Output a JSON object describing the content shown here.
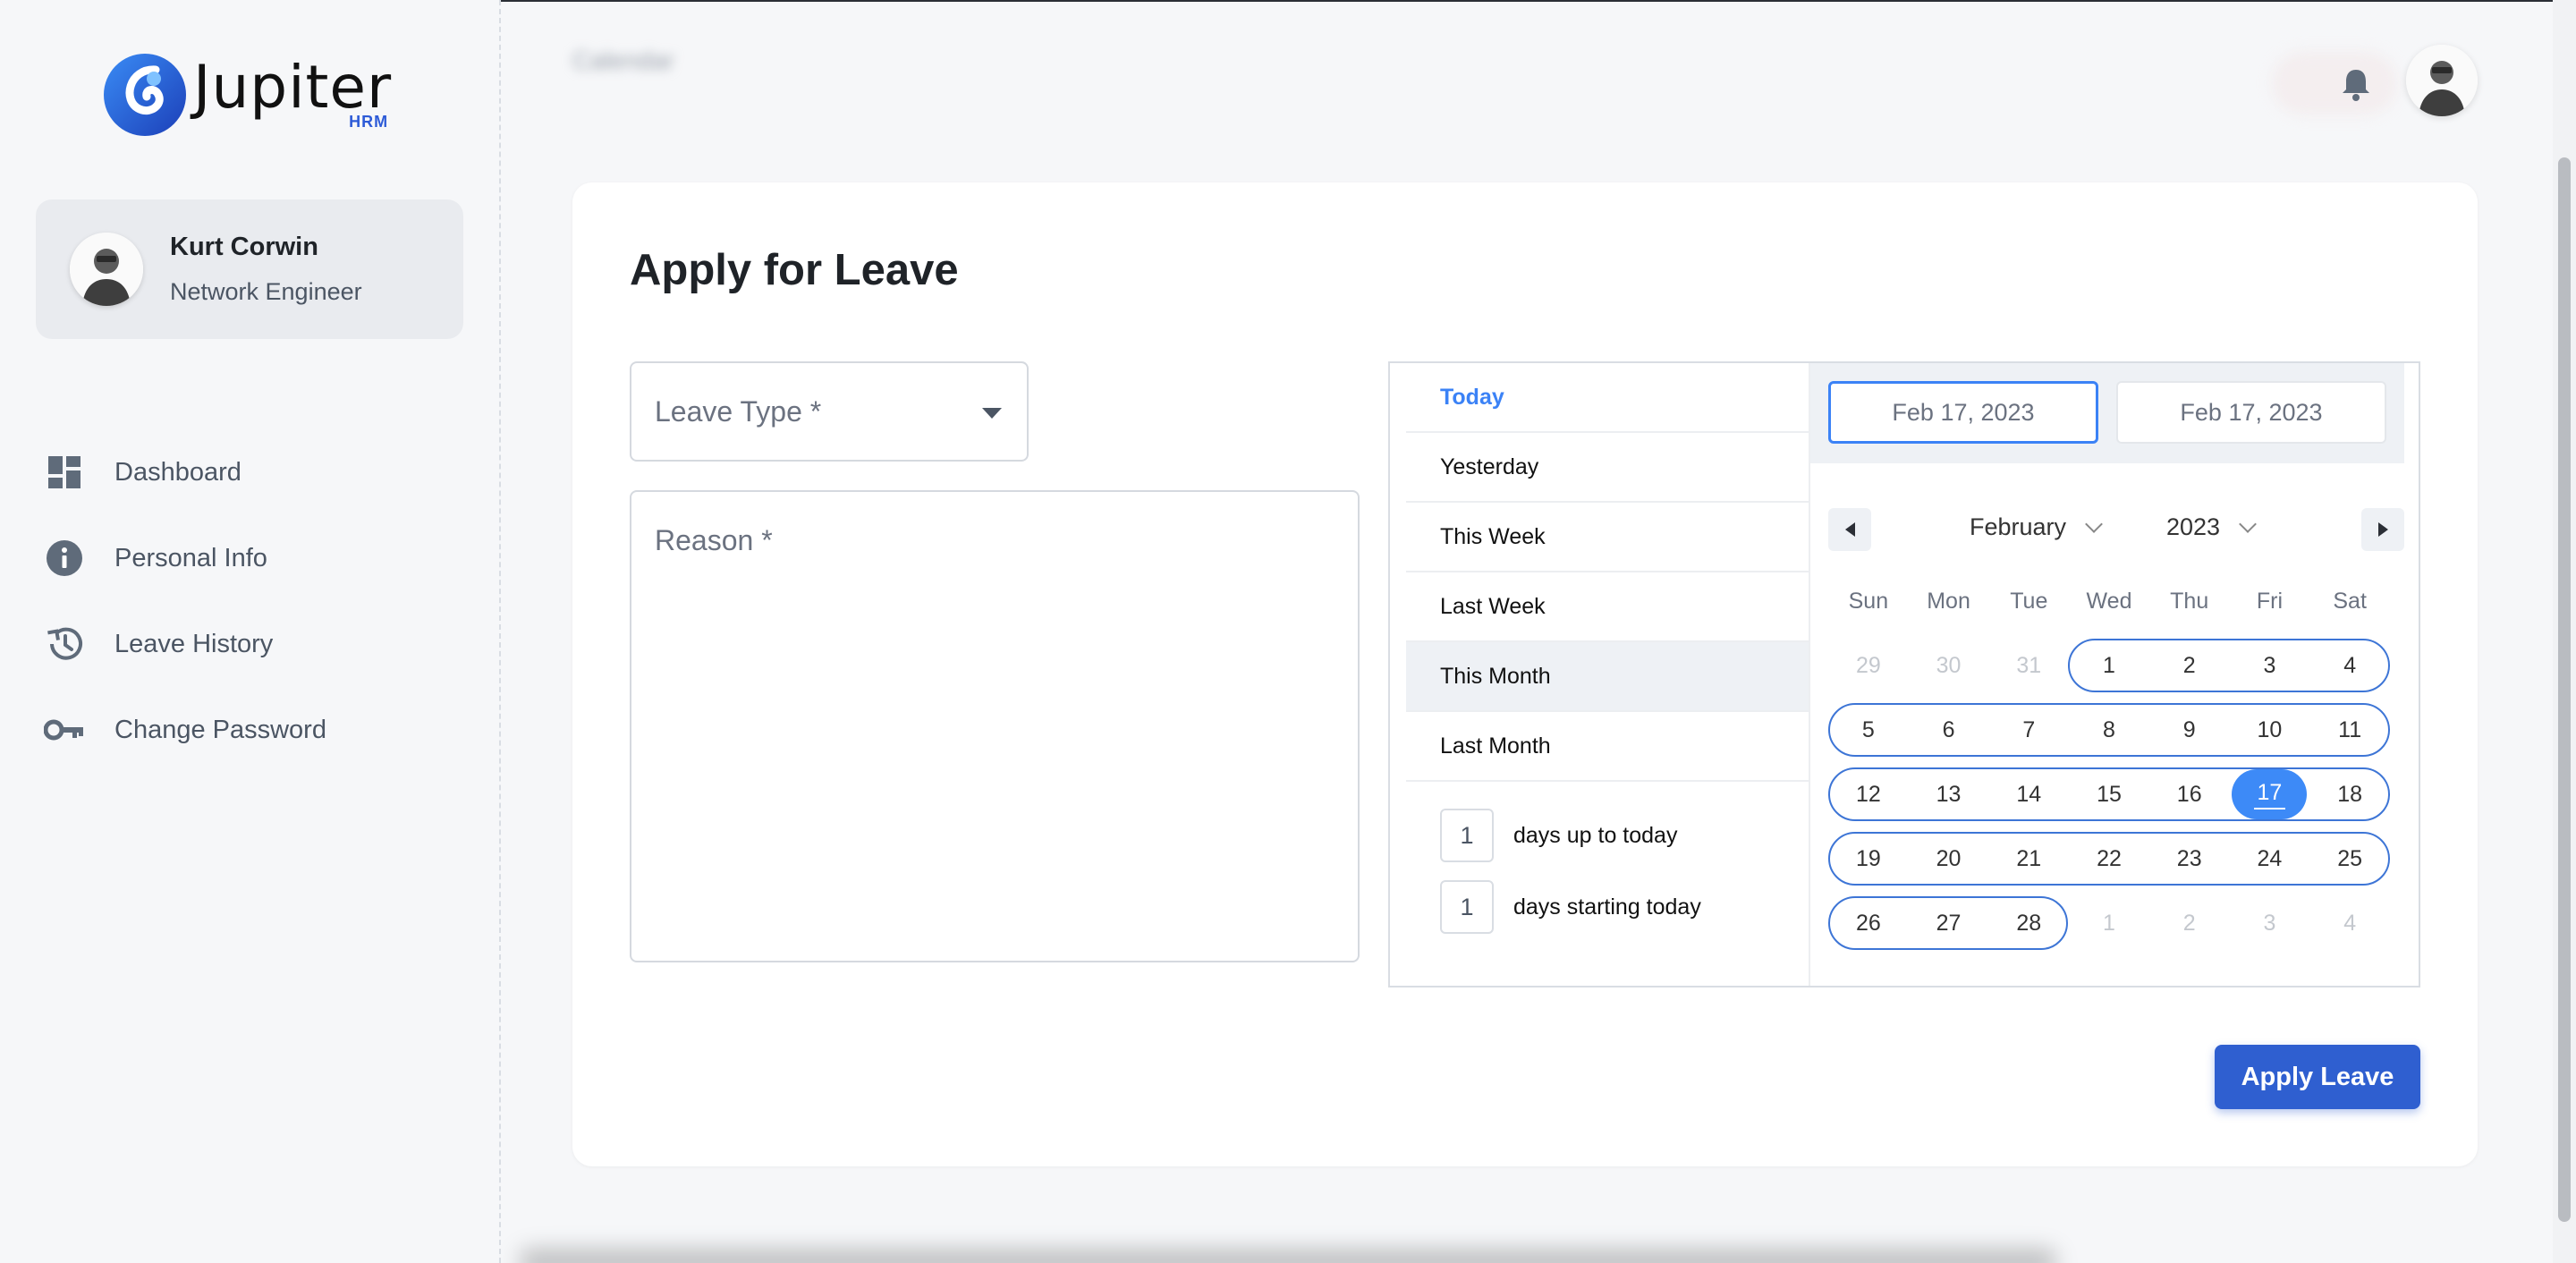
{
  "brand": {
    "name": "Jupiter",
    "sub": "HRM",
    "accent": "#2d5bd7"
  },
  "profile": {
    "name": "Kurt Corwin",
    "role": "Network Engineer"
  },
  "nav": [
    {
      "label": "Dashboard",
      "icon": "dashboard-icon"
    },
    {
      "label": "Personal Info",
      "icon": "info-icon"
    },
    {
      "label": "Leave History",
      "icon": "history-icon"
    },
    {
      "label": "Change Password",
      "icon": "key-icon"
    }
  ],
  "header": {
    "title": "Calendar"
  },
  "form": {
    "title": "Apply for Leave",
    "leave_type_label": "Leave Type *",
    "reason_label": "Reason *",
    "submit_label": "Apply Leave"
  },
  "picker": {
    "ranges": [
      "Today",
      "Yesterday",
      "This Week",
      "Last Week",
      "This Month",
      "Last Month"
    ],
    "active_range": "This Month",
    "days_up_value": "1",
    "days_up_label": "days up to today",
    "days_start_value": "1",
    "days_start_label": "days starting today",
    "start_date": "Feb 17, 2023",
    "end_date": "Feb 17, 2023",
    "month": "February",
    "year": "2023",
    "weekdays": [
      "Sun",
      "Mon",
      "Tue",
      "Wed",
      "Thu",
      "Fri",
      "Sat"
    ],
    "weeks": [
      [
        "29",
        "30",
        "31",
        "1",
        "2",
        "3",
        "4"
      ],
      [
        "5",
        "6",
        "7",
        "8",
        "9",
        "10",
        "11"
      ],
      [
        "12",
        "13",
        "14",
        "15",
        "16",
        "17",
        "18"
      ],
      [
        "19",
        "20",
        "21",
        "22",
        "23",
        "24",
        "25"
      ],
      [
        "26",
        "27",
        "28",
        "1",
        "2",
        "3",
        "4"
      ]
    ],
    "today": "17",
    "selection_color": "#3d75d6"
  }
}
